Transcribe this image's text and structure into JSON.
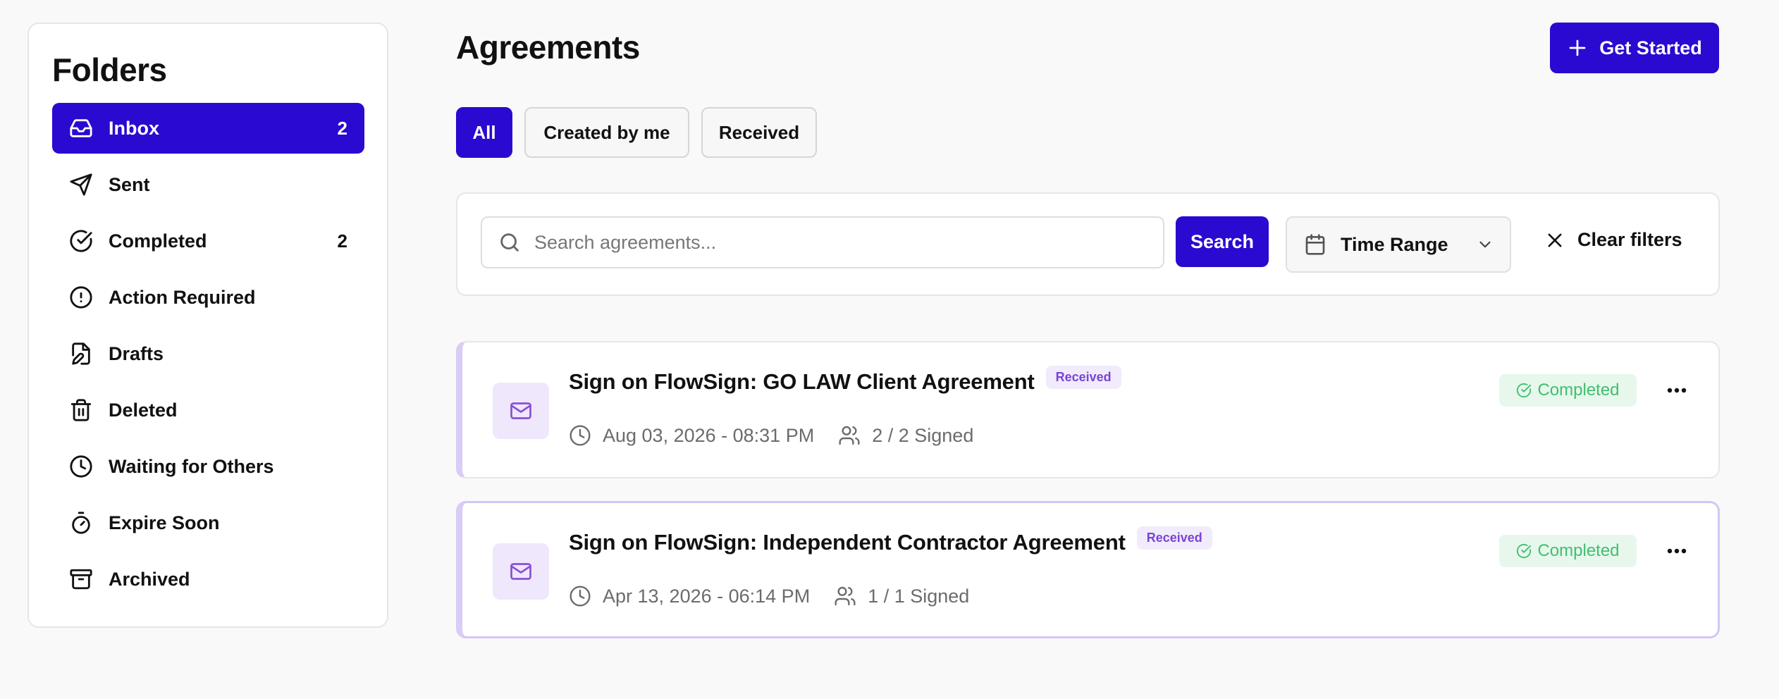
{
  "sidebar": {
    "title": "Folders",
    "items": [
      {
        "label": "Inbox",
        "count": "2",
        "icon": "inbox-icon",
        "active": true
      },
      {
        "label": "Sent",
        "count": "",
        "icon": "send-icon"
      },
      {
        "label": "Completed",
        "count": "2",
        "icon": "check-circle-icon"
      },
      {
        "label": "Action Required",
        "count": "",
        "icon": "alert-circle-icon"
      },
      {
        "label": "Drafts",
        "count": "",
        "icon": "file-edit-icon"
      },
      {
        "label": "Deleted",
        "count": "",
        "icon": "trash-icon"
      },
      {
        "label": "Waiting for Others",
        "count": "",
        "icon": "clock-icon"
      },
      {
        "label": "Expire Soon",
        "count": "",
        "icon": "timer-icon"
      },
      {
        "label": "Archived",
        "count": "",
        "icon": "archive-icon"
      }
    ]
  },
  "header": {
    "title": "Agreements",
    "cta_label": "Get Started"
  },
  "tabs": [
    {
      "label": "All",
      "active": true
    },
    {
      "label": "Created by me"
    },
    {
      "label": "Received"
    }
  ],
  "filters": {
    "search_placeholder": "Search agreements...",
    "search_value": "",
    "search_button": "Search",
    "time_range_label": "Time Range",
    "clear_label": "Clear filters"
  },
  "agreements": [
    {
      "title": "Sign on FlowSign: GO LAW Client Agreement",
      "tag": "Received",
      "date": "Aug 03, 2026 - 08:31 PM",
      "signed": "2 / 2 Signed",
      "status": "Completed"
    },
    {
      "title": "Sign on FlowSign: Independent Contractor Agreement",
      "tag": "Received",
      "date": "Apr 13, 2026 - 06:14 PM",
      "signed": "1 / 1 Signed",
      "status": "Completed"
    }
  ],
  "colors": {
    "accent": "#2a0ad0",
    "card_stripe": "#d9ccf7",
    "received_badge_bg": "#f1ebfb",
    "received_badge_text": "#7a43d6",
    "completed_bg": "#e7f7ec",
    "completed_text": "#3fbf6f"
  }
}
